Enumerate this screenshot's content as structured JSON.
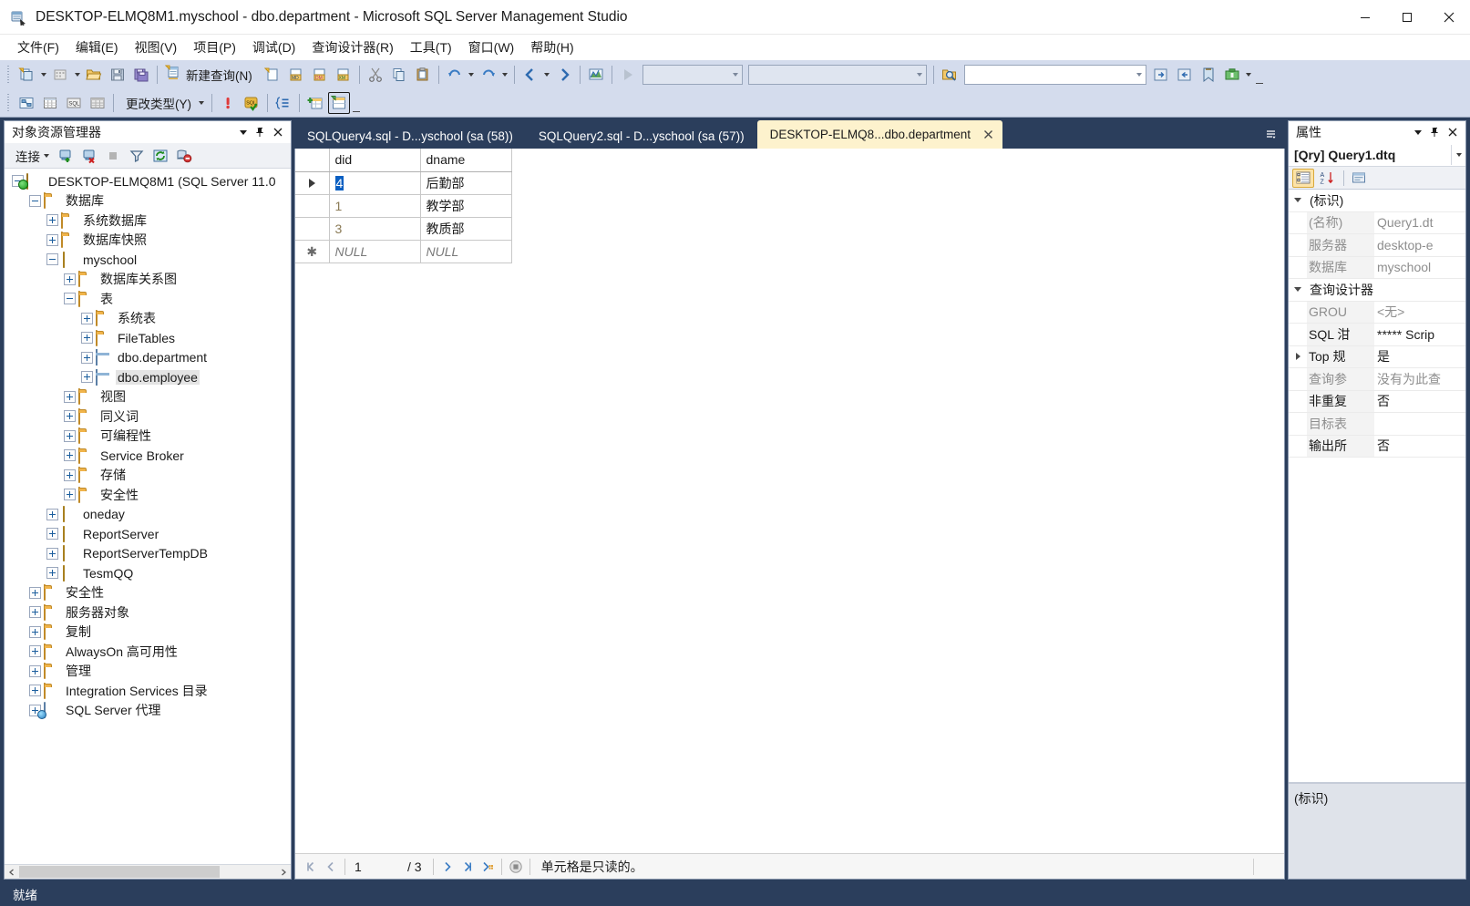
{
  "window": {
    "title": "DESKTOP-ELMQ8M1.myschool - dbo.department - Microsoft SQL Server Management Studio",
    "app_icon": "ssms-icon",
    "minimize": "minimize-icon",
    "maximize": "maximize-icon",
    "close": "close-icon"
  },
  "menu": {
    "items": [
      {
        "label": "文件(F)"
      },
      {
        "label": "编辑(E)"
      },
      {
        "label": "视图(V)"
      },
      {
        "label": "项目(P)"
      },
      {
        "label": "调试(D)"
      },
      {
        "label": "查询设计器(R)"
      },
      {
        "label": "工具(T)"
      },
      {
        "label": "窗口(W)"
      },
      {
        "label": "帮助(H)"
      }
    ]
  },
  "toolbar": {
    "new_query_label": "新建查询(N)",
    "change_type_label": "更改类型(Y)",
    "combo1_value": "",
    "combo2_value": "",
    "combo3_value": ""
  },
  "object_explorer": {
    "title": "对象资源管理器",
    "connect_label": "连接",
    "tree": [
      {
        "label": "DESKTOP-ELMQ8M1 (SQL Server 11.0",
        "indent": 0,
        "expander": "minus",
        "icon": "server-icon"
      },
      {
        "label": "数据库",
        "indent": 1,
        "expander": "minus",
        "icon": "folder-icon"
      },
      {
        "label": "系统数据库",
        "indent": 2,
        "expander": "plus",
        "icon": "folder-icon"
      },
      {
        "label": "数据库快照",
        "indent": 2,
        "expander": "plus",
        "icon": "folder-icon"
      },
      {
        "label": "myschool",
        "indent": 2,
        "expander": "minus",
        "icon": "database-icon"
      },
      {
        "label": "数据库关系图",
        "indent": 3,
        "expander": "plus",
        "icon": "folder-icon"
      },
      {
        "label": "表",
        "indent": 3,
        "expander": "minus",
        "icon": "folder-icon"
      },
      {
        "label": "系统表",
        "indent": 4,
        "expander": "plus",
        "icon": "folder-icon"
      },
      {
        "label": "FileTables",
        "indent": 4,
        "expander": "plus",
        "icon": "folder-icon"
      },
      {
        "label": "dbo.department",
        "indent": 4,
        "expander": "plus",
        "icon": "table-icon"
      },
      {
        "label": "dbo.employee",
        "indent": 4,
        "expander": "plus",
        "icon": "table-icon",
        "selected": true
      },
      {
        "label": "视图",
        "indent": 3,
        "expander": "plus",
        "icon": "folder-icon"
      },
      {
        "label": "同义词",
        "indent": 3,
        "expander": "plus",
        "icon": "folder-icon"
      },
      {
        "label": "可编程性",
        "indent": 3,
        "expander": "plus",
        "icon": "folder-icon"
      },
      {
        "label": "Service Broker",
        "indent": 3,
        "expander": "plus",
        "icon": "folder-icon"
      },
      {
        "label": "存储",
        "indent": 3,
        "expander": "plus",
        "icon": "folder-icon"
      },
      {
        "label": "安全性",
        "indent": 3,
        "expander": "plus",
        "icon": "folder-icon"
      },
      {
        "label": "oneday",
        "indent": 2,
        "expander": "plus",
        "icon": "database-icon"
      },
      {
        "label": "ReportServer",
        "indent": 2,
        "expander": "plus",
        "icon": "database-icon"
      },
      {
        "label": "ReportServerTempDB",
        "indent": 2,
        "expander": "plus",
        "icon": "database-icon"
      },
      {
        "label": "TesmQQ",
        "indent": 2,
        "expander": "plus",
        "icon": "database-icon"
      },
      {
        "label": "安全性",
        "indent": 1,
        "expander": "plus",
        "icon": "folder-icon"
      },
      {
        "label": "服务器对象",
        "indent": 1,
        "expander": "plus",
        "icon": "folder-icon"
      },
      {
        "label": "复制",
        "indent": 1,
        "expander": "plus",
        "icon": "folder-icon"
      },
      {
        "label": "AlwaysOn 高可用性",
        "indent": 1,
        "expander": "plus",
        "icon": "folder-icon"
      },
      {
        "label": "管理",
        "indent": 1,
        "expander": "plus",
        "icon": "folder-icon"
      },
      {
        "label": "Integration Services 目录",
        "indent": 1,
        "expander": "plus",
        "icon": "folder-icon"
      },
      {
        "label": "SQL Server 代理",
        "indent": 1,
        "expander": "plus",
        "icon": "agent-icon"
      }
    ]
  },
  "tabs": [
    {
      "label": "SQLQuery4.sql - D...yschool (sa (58))",
      "active": false
    },
    {
      "label": "SQLQuery2.sql - D...yschool (sa (57))",
      "active": false
    },
    {
      "label": "DESKTOP-ELMQ8...dbo.department",
      "active": true
    }
  ],
  "grid": {
    "columns": [
      "did",
      "dname"
    ],
    "rows": [
      {
        "marker": "current",
        "did": "4",
        "dname": "后勤部",
        "did_selected": true,
        "dname_dark": true
      },
      {
        "marker": "",
        "did": "1",
        "dname": "教学部",
        "did_selected": false,
        "dname_dark": true
      },
      {
        "marker": "",
        "did": "3",
        "dname": "教质部",
        "did_selected": false,
        "dname_dark": true
      },
      {
        "marker": "new",
        "did": "NULL",
        "dname": "NULL",
        "is_null": true
      }
    ]
  },
  "navigation": {
    "current_page": "1",
    "total": "/ 3",
    "message": "单元格是只读的。",
    "first_icon": "first-record-icon",
    "prev_icon": "previous-record-icon",
    "next_icon": "next-record-icon",
    "last_icon": "last-record-icon",
    "new_icon": "new-record-icon",
    "stop_icon": "stop-icon"
  },
  "properties": {
    "title": "属性",
    "selector": "[Qry] Query1.dtq",
    "rows": [
      {
        "type": "category",
        "name": "(标识)",
        "value": "",
        "chevron": "down"
      },
      {
        "type": "prop",
        "name": "(名称)",
        "value": "Query1.dt",
        "dim_name": true,
        "dim_value": true
      },
      {
        "type": "prop",
        "name": "服务器",
        "value": "desktop-e",
        "dim_name": true,
        "dim_value": true
      },
      {
        "type": "prop",
        "name": "数据库",
        "value": "myschool",
        "dim_name": true,
        "dim_value": true
      },
      {
        "type": "category",
        "name": "查询设计器",
        "value": "",
        "chevron": "down"
      },
      {
        "type": "prop",
        "name": "GROU",
        "value": "<无>",
        "dim_name": true,
        "dim_value": true
      },
      {
        "type": "prop",
        "name": "SQL 泔",
        "value": "***** Scrip",
        "dim_name": false,
        "dim_value": false
      },
      {
        "type": "prop",
        "name": "Top 规",
        "value": "是",
        "chevron": "right",
        "dim_name": false,
        "dim_value": false
      },
      {
        "type": "prop",
        "name": "查询参",
        "value": "没有为此查",
        "dim_name": true,
        "dim_value": true
      },
      {
        "type": "prop",
        "name": "非重复",
        "value": "否",
        "dim_name": false,
        "dim_value": false
      },
      {
        "type": "prop",
        "name": "目标表",
        "value": "",
        "dim_name": true,
        "dim_value": true
      },
      {
        "type": "prop",
        "name": "输出所",
        "value": "否",
        "dim_name": false,
        "dim_value": false
      }
    ],
    "description_title": "(标识)"
  },
  "statusbar": {
    "text": "就绪"
  },
  "colors": {
    "title_bar": "#ffffff",
    "chrome_dark": "#2b3e5c",
    "toolbar": "#d4dced",
    "active_tab": "#fdf2cd",
    "selection_blue": "#0a5fc2",
    "folder_gold": "#f0b44b"
  }
}
